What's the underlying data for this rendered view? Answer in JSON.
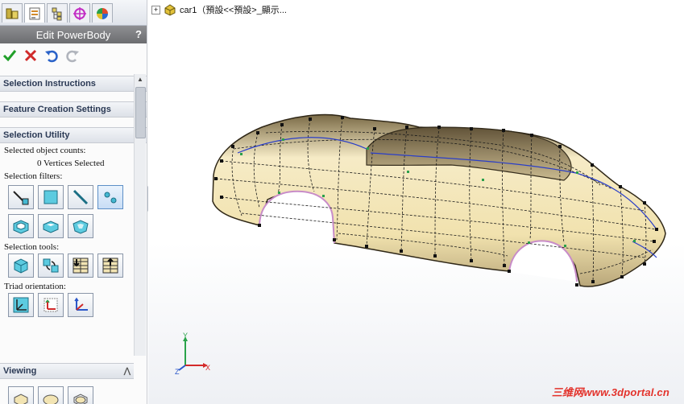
{
  "property_manager": {
    "title": "Edit PowerBody",
    "help": "?",
    "tabs": [
      "feature-manager-icon",
      "property-manager-icon",
      "configuration-manager-icon",
      "dimxpert-icon",
      "display-manager-icon"
    ],
    "actions": [
      "ok-icon",
      "cancel-icon",
      "undo-icon",
      "redo-icon"
    ],
    "groups": {
      "selection_instructions": "Selection Instructions",
      "feature_creation_settings": "Feature Creation Settings",
      "selection_utility": "Selection Utility",
      "viewing": "Viewing"
    },
    "selection_utility": {
      "counts_label": "Selected object counts:",
      "counts_value": "0 Vertices Selected",
      "filters_label": "Selection filters:",
      "tools_label": "Selection tools:",
      "triad_label": "Triad orientation:"
    }
  },
  "tree": {
    "expander": "+",
    "item": "car1（預設<<預設>_顯示..."
  },
  "axes": {
    "x": "X",
    "y": "Y",
    "z": "Z"
  },
  "watermark": "三维网www.3dportal.cn",
  "colors": {
    "accent": "#2b3a55",
    "car_body": "#f2e4b3",
    "axis_x": "#d42a2a",
    "axis_y": "#2aa34a",
    "axis_z": "#2a57c9",
    "watermark": "#e3322b"
  }
}
